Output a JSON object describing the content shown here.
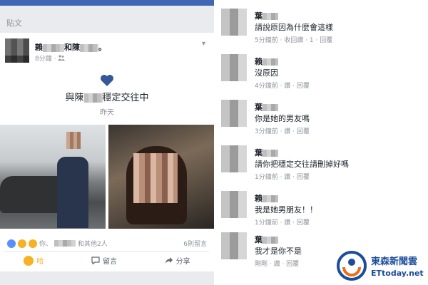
{
  "post": {
    "section_title": "貼文",
    "poster_first": "賴",
    "poster_join": "和陳",
    "poster_end": "。",
    "time": "8分鐘",
    "status_prefix": "與陳",
    "status_suffix": "穩定交往中",
    "status_when": "昨天",
    "reactions_text": "你、",
    "reactions_tail": "和其他2人",
    "comments_count": "6則留言",
    "action_like": "哈",
    "action_comment": "留言",
    "action_share": "分享"
  },
  "comments": [
    {
      "name": "葉",
      "text": "請說原因為什麼會這樣",
      "meta": "5分鐘前 · 收回讚 · 1 · 回覆",
      "likes": "1"
    },
    {
      "name": "賴",
      "text": "沒原因",
      "meta": "4分鐘前 · 讚 · 回覆"
    },
    {
      "name": "葉",
      "text": "你是她的男友嗎",
      "meta": "3分鐘前 · 讚 · 回覆"
    },
    {
      "name": "葉",
      "text": "請你把穩定交往請刪掉好嗎",
      "meta": "1分鐘前 · 讚 · 回覆"
    },
    {
      "name": "賴",
      "text": "我是她男朋友！！",
      "meta": "1分鐘前 · 讚 · 回覆"
    },
    {
      "name": "葉",
      "text": "我才是你不是",
      "meta": "剛剛 · 讚 · 回覆"
    }
  ],
  "watermark": {
    "brand_cn": "東森新聞雲",
    "brand_en": "ETtoday.net"
  },
  "colors": {
    "fb_blue": "#4267b2",
    "heart": "#365899",
    "brand": "#1b4d9a"
  }
}
